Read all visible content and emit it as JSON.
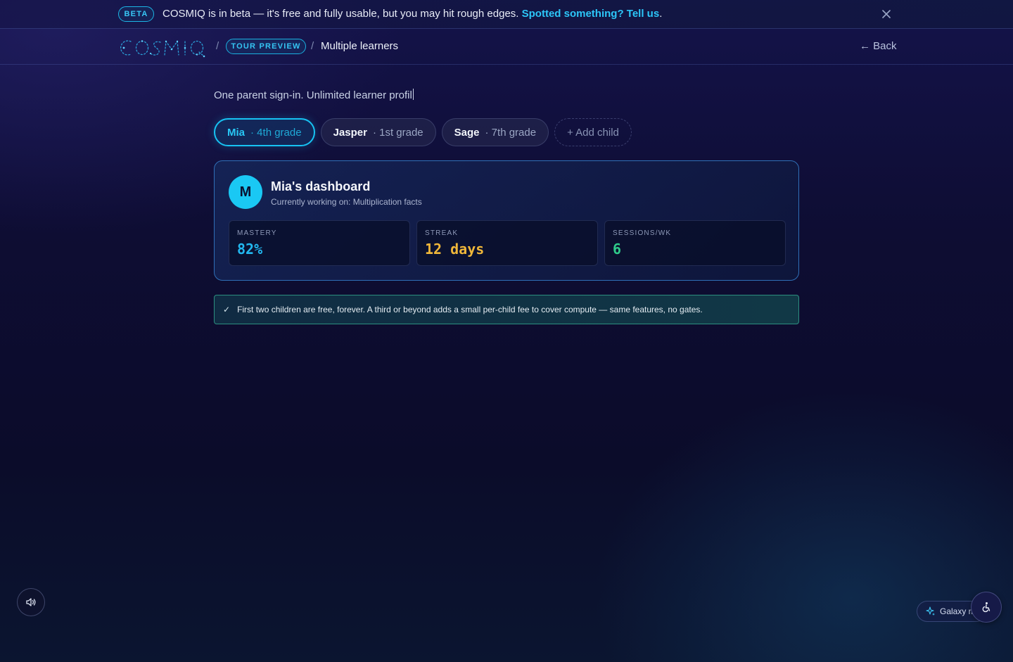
{
  "banner": {
    "badge": "BETA",
    "message": "COSMIQ is in beta — it's free and fully usable, but you may hit rough edges. ",
    "link": "Spotted something? Tell us",
    "suffix": "."
  },
  "nav": {
    "logo_text": "COSMIQ",
    "sep": "/",
    "tour_badge": "TOUR PREVIEW",
    "current": "Multiple learners",
    "back": "← Back"
  },
  "main": {
    "lead": "One parent sign-in. Unlimited learner profil",
    "tabs": [
      {
        "name": "Mia",
        "grade": "· 4th grade"
      },
      {
        "name": "Jasper",
        "grade": "· 1st grade"
      },
      {
        "name": "Sage",
        "grade": "· 7th grade"
      }
    ],
    "add_child": "+ Add child",
    "dashboard": {
      "avatar": "M",
      "title": "Mia's dashboard",
      "subtitle": "Currently working on: Multiplication facts",
      "stats": [
        {
          "label": "MASTERY",
          "value": "82%",
          "color": "#22b8f0"
        },
        {
          "label": "STREAK",
          "value": "12 days",
          "color": "#f0b73a"
        },
        {
          "label": "SESSIONS/WK",
          "value": "6",
          "color": "#2fcb8a"
        }
      ]
    },
    "notice": {
      "icon": "check-icon",
      "text": "First two children are free, forever. A third or beyond adds a small per-child fee to cover compute — same features, no gates."
    }
  },
  "floating": {
    "galaxy_label": "Galaxy m"
  },
  "colors": {
    "accent": "#17c3f3",
    "notice_border": "#2c8f80"
  }
}
